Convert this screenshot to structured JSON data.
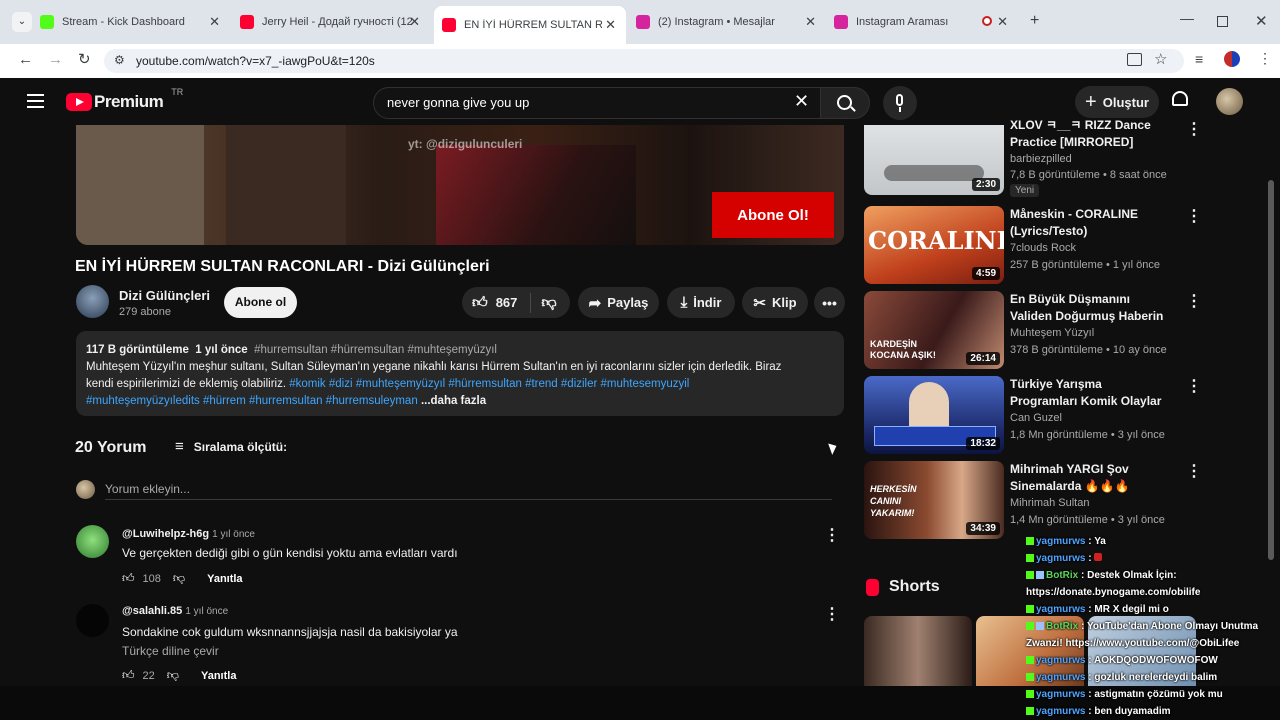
{
  "browser": {
    "tabs": [
      {
        "title": "Stream - Kick Dashboard",
        "icon": "kick-icon",
        "color": "#53fc18"
      },
      {
        "title": "Jerry Heil - Додай гучності (12",
        "icon": "youtube-icon",
        "color": "#ff0033"
      },
      {
        "title": "EN İYİ HÜRREM SULTAN RACON",
        "icon": "youtube-icon",
        "color": "#ff0033"
      },
      {
        "title": "(2) Instagram • Mesajlar",
        "icon": "instagram-icon",
        "color": "#d6249f"
      },
      {
        "title": "Instagram Araması",
        "icon": "instagram-icon",
        "color": "#d6249f"
      }
    ],
    "url": "youtube.com/watch?v=x7_-iawgPoU&t=120s"
  },
  "youtube": {
    "logo_text": "Premium",
    "region": "TR",
    "search_value": "never gonna give you up",
    "create_label": "Oluştur",
    "video": {
      "watermark": "yt: @dizigulunculeri",
      "subscribe_overlay": "Abone Ol!",
      "title": "EN İYİ HÜRREM SULTAN RACONLARI - Dizi Gülünçleri",
      "channel": "Dizi Gülünçleri",
      "subscribers": "279 abone",
      "subscribe_button": "Abone ol",
      "likes": "867",
      "share": "Paylaş",
      "download": "İndir",
      "clip": "Klip"
    },
    "description": {
      "views": "117 B görüntüleme",
      "age": "1 yıl önce",
      "tags_top": "#hurremsultan #hürremsultan #muhteşemyüzyıl",
      "text": "Muhteşem Yüzyıl'ın meşhur sultanı, Sultan Süleyman'ın yegane nikahlı karısı Hürrem Sultan'ın en iyi raconlarını sizler için derledik. Biraz kendi espirilerimizi de eklemiş olabiliriz.",
      "hashtags": "#komik #dizi #muhteşemyüzyıl #hürremsultan #trend #diziler #muhtesemyuzyil #muhteşemyüzyıledits #hürrem #hurremsultan #hurremsuleyman",
      "more": "...daha fazla"
    },
    "comments": {
      "count_label": "20 Yorum",
      "sort_label": "Sıralama ölçütü:",
      "add_placeholder": "Yorum ekleyin...",
      "items": [
        {
          "author": "@Luwihelpz-h6g",
          "time": "1 yıl önce",
          "text": "Ve gerçekten dediği gibi o gün kendisi yoktu ama evlatları vardı",
          "likes": "108",
          "reply": "Yanıtla",
          "translate": ""
        },
        {
          "author": "@salahli.85",
          "time": "1 yıl önce",
          "text": "Sondakine cok guldum wksnnannsjjajsja nasil da bakisiyolar ya",
          "likes": "22",
          "reply": "Yanıtla",
          "translate": "Türkçe diline çevir"
        }
      ]
    },
    "sidebar": [
      {
        "title": "XLOV ㅋ__ㅋ RIZZ Dance Practice [MIRRORED]",
        "channel": "barbiezpilled",
        "meta": "7,8 B görüntüleme • 8 saat önce",
        "duration": "2:30",
        "badge": "Yeni",
        "thumb": "#cfd3d6",
        "thumb_text": ""
      },
      {
        "title": "Måneskin - CORALINE (Lyrics/Testo)",
        "channel": "7clouds Rock",
        "meta": "257 B görüntüleme • 1 yıl önce",
        "duration": "4:59",
        "badge": "",
        "thumb": "#c9542c",
        "thumb_text": "CORALINE"
      },
      {
        "title": "En Büyük Düşmanını Validen Doğurmuş Haberin Yok 😏 | ...",
        "channel": "Muhteşem Yüzyıl",
        "meta": "378 B görüntüleme • 10 ay önce",
        "duration": "26:14",
        "badge": "",
        "thumb": "#5a2a2a",
        "thumb_text": "KARDEŞİN KOCANA AŞIK!"
      },
      {
        "title": "Türkiye Yarışma Programları Komik Olaylar",
        "channel": "Can Guzel",
        "meta": "1,8 Mn görüntüleme • 3 yıl önce",
        "duration": "18:32",
        "badge": "",
        "thumb": "#2b4b9a",
        "thumb_text": ""
      },
      {
        "title": "Mihrimah YARGI Şov Sinemalarda 🔥🔥🔥",
        "channel": "Mihrimah Sultan",
        "meta": "1,4 Mn görüntüleme • 3 yıl önce",
        "duration": "34:39",
        "badge": "",
        "thumb": "#7a3d2a",
        "thumb_text": "HERKESİN CANINI YAKARIM!"
      }
    ],
    "shorts_label": "Shorts"
  },
  "chat": [
    {
      "user": "yagmurws",
      "text": "Ya",
      "green": false
    },
    {
      "user": "yagmurws",
      "text": "",
      "green": false
    },
    {
      "user": "BotRix",
      "text": "Destek Olmak İçin: https://donate.bynogame.com/obilife",
      "green": true
    },
    {
      "user": "yagmurws",
      "text": "MR X degil mi o",
      "green": false
    },
    {
      "user": "BotRix",
      "text": "YouTube'dan Abone Olmayı Unutma Zwanzi! https://www.youtube.com/@ObiLifee",
      "green": true
    },
    {
      "user": "yagmurws",
      "text": "AOKDQODWOFOWOFOW",
      "green": false
    },
    {
      "user": "yagmurws",
      "text": "gozluk nerelerdeydi balim",
      "green": false
    },
    {
      "user": "yagmurws",
      "text": "astigmatın çözümü yok mu",
      "green": false
    },
    {
      "user": "yagmurws",
      "text": "ben duyamadim",
      "green": false
    }
  ]
}
